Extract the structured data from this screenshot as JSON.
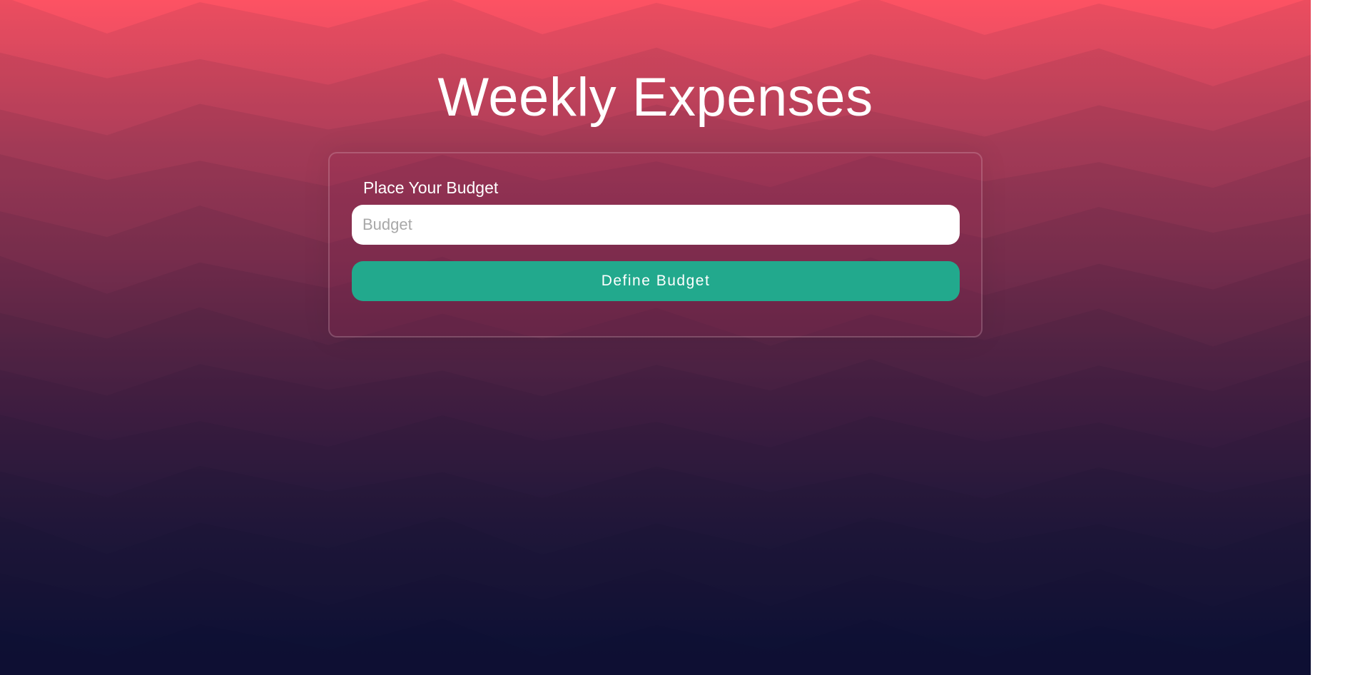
{
  "page": {
    "title": "Weekly Expenses"
  },
  "budget_form": {
    "label": "Place Your Budget",
    "input_value": "",
    "input_placeholder": "Budget",
    "submit_label": "Define Budget"
  },
  "colors": {
    "gradient_top": "#fd5263",
    "gradient_bottom": "#101c4a",
    "button": "#22a98d",
    "input_background": "#ffffff",
    "text": "#ffffff"
  }
}
